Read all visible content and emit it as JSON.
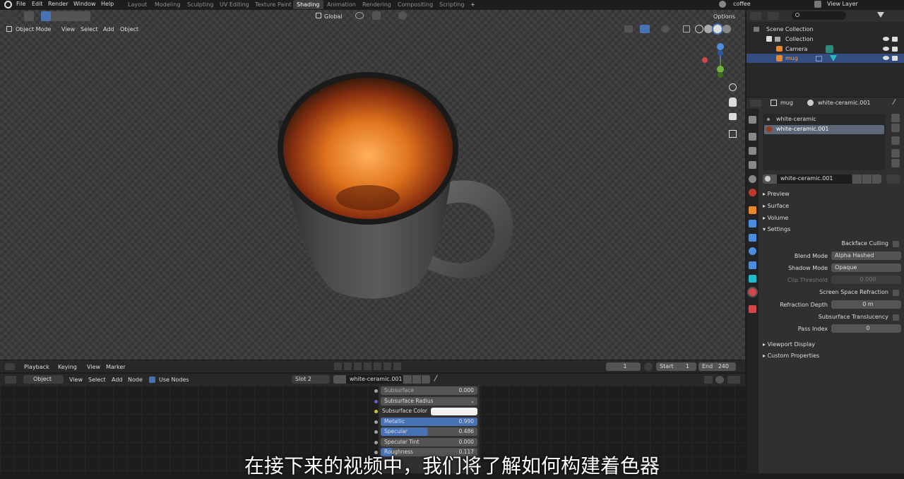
{
  "topbar": {
    "menus": [
      "File",
      "Edit",
      "Render",
      "Window",
      "Help"
    ],
    "workspaces": [
      "Layout",
      "Modeling",
      "Sculpting",
      "UV Editing",
      "Texture Paint",
      "Shading",
      "Animation",
      "Rendering",
      "Compositing",
      "Scripting"
    ],
    "active_workspace": "Shading",
    "add_tab": "+",
    "scene_name": "coffee",
    "view_layer": "View Layer"
  },
  "viewport": {
    "mode": "Object Mode",
    "menus": [
      "View",
      "Select",
      "Add",
      "Object"
    ],
    "transform_orientation": "Global",
    "options": "Options"
  },
  "outliner": {
    "search_placeholder": "",
    "scene_collection": "Scene Collection",
    "collection": "Collection",
    "items": [
      "Camera",
      "mug"
    ]
  },
  "properties": {
    "object_name": "mug",
    "material_name": "white-ceramic.001",
    "slots": [
      "white-ceramic",
      "white-ceramic.001"
    ],
    "material_field": "white-ceramic.001",
    "panels": [
      "Preview",
      "Surface",
      "Volume",
      "Settings"
    ],
    "settings": {
      "backface_culling": "Backface Culling",
      "blend_mode_label": "Blend Mode",
      "blend_mode": "Alpha Hashed",
      "shadow_mode_label": "Shadow Mode",
      "shadow_mode": "Opaque",
      "clip_threshold_label": "Clip Threshold",
      "clip_threshold": "0.000",
      "ssr": "Screen Space Refraction",
      "refraction_depth_label": "Refraction Depth",
      "refraction_depth": "0 m",
      "sss_translucency": "Subsurface Translucency",
      "pass_index_label": "Pass Index",
      "pass_index": "0"
    },
    "extra_panels": [
      "Viewport Display",
      "Custom Properties"
    ]
  },
  "timeline": {
    "menus": [
      "Playback",
      "Keying",
      "View",
      "Marker"
    ],
    "current_frame": "1",
    "start_label": "Start",
    "start": "1",
    "end_label": "End",
    "end": "240"
  },
  "node_editor": {
    "mode": "Object",
    "menus": [
      "View",
      "Select",
      "Add",
      "Node"
    ],
    "use_nodes": "Use Nodes",
    "slot": "Slot 2",
    "material": "white-ceramic.001",
    "rows": [
      {
        "label": "Subsurface",
        "value": "0.000"
      },
      {
        "label": "Subsurface Radius",
        "value": ""
      },
      {
        "label": "Subsurface Color",
        "value": ""
      },
      {
        "label": "Metallic",
        "value": "0.990"
      },
      {
        "label": "Specular",
        "value": "0.486"
      },
      {
        "label": "Specular Tint",
        "value": "0.000"
      },
      {
        "label": "Roughness",
        "value": "0.117"
      }
    ]
  },
  "subtitle": "在接下来的视频中，我们将了解如何构建着色器",
  "colors": {
    "accent": "#4772b3",
    "mug_highlight": "#4772b3",
    "orange": "#e8872b"
  }
}
